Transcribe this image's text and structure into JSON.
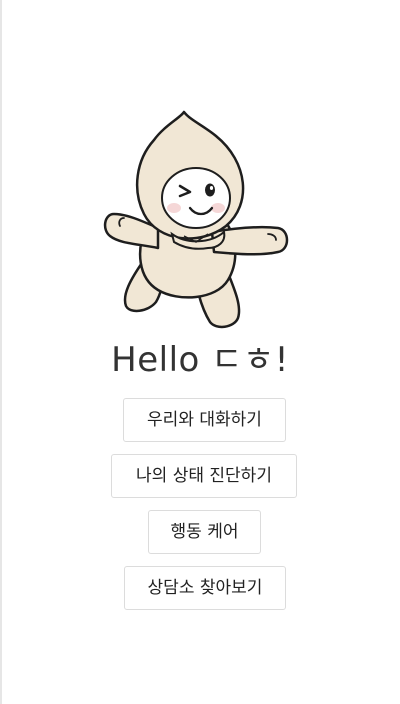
{
  "greeting": "Hello ㄷㅎ!",
  "menu": {
    "chat": "우리와 대화하기",
    "diagnosis": "나의 상태 진단하기",
    "behavior_care": "행동 케어",
    "find_counseling": "상담소 찾아보기"
  },
  "colors": {
    "mascot_body": "#f1e7d5",
    "mascot_outline": "#1e1e1e",
    "text": "#333333",
    "button_border": "#dcdcdc"
  }
}
